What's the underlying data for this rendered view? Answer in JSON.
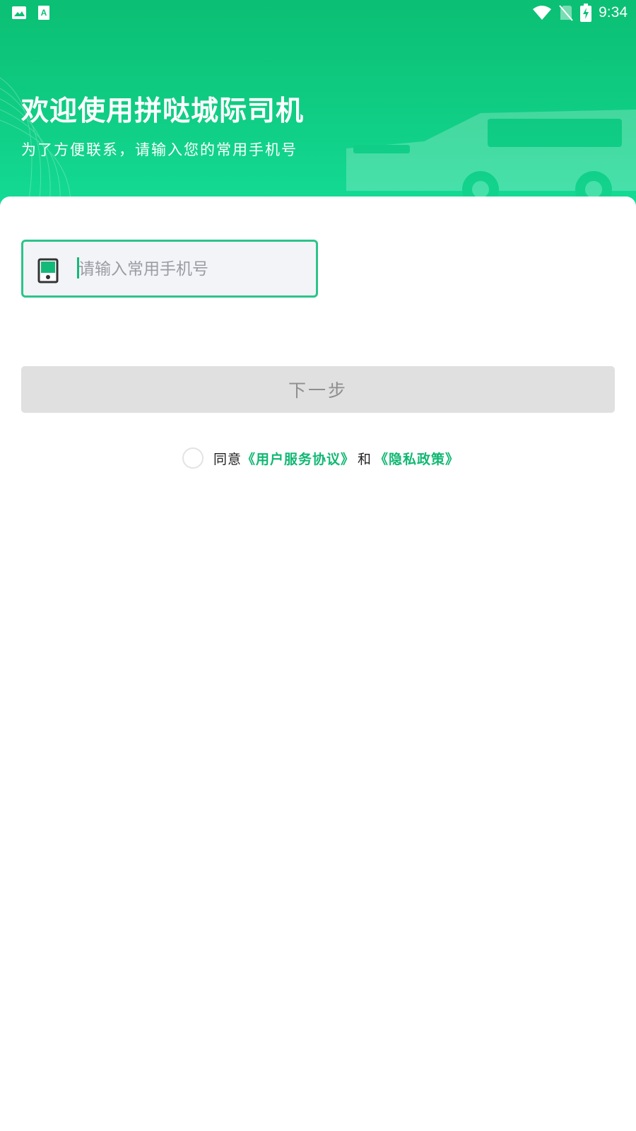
{
  "status_bar": {
    "time": "9:34",
    "left_icons": [
      "image-icon",
      "text-a-icon"
    ],
    "right_icons": [
      "wifi-icon",
      "no-sim-icon",
      "battery-charging-icon"
    ]
  },
  "header": {
    "title": "欢迎使用拼哒城际司机",
    "subtitle": "为了方便联系，请输入您的常用手机号"
  },
  "phone_field": {
    "placeholder": "请输入常用手机号",
    "value": "",
    "icon": "phone-icon"
  },
  "next_button": {
    "label": "下一步",
    "enabled": false
  },
  "agreement": {
    "checked": false,
    "prefix": "同意",
    "terms_link": "《用户服务协议》",
    "conjunction": "和",
    "privacy_link": "《隐私政策》"
  },
  "colors": {
    "brand_green": "#10c27d",
    "link_green": "#10b872",
    "field_border": "#2cc489",
    "button_disabled": "#e0e0e0"
  }
}
